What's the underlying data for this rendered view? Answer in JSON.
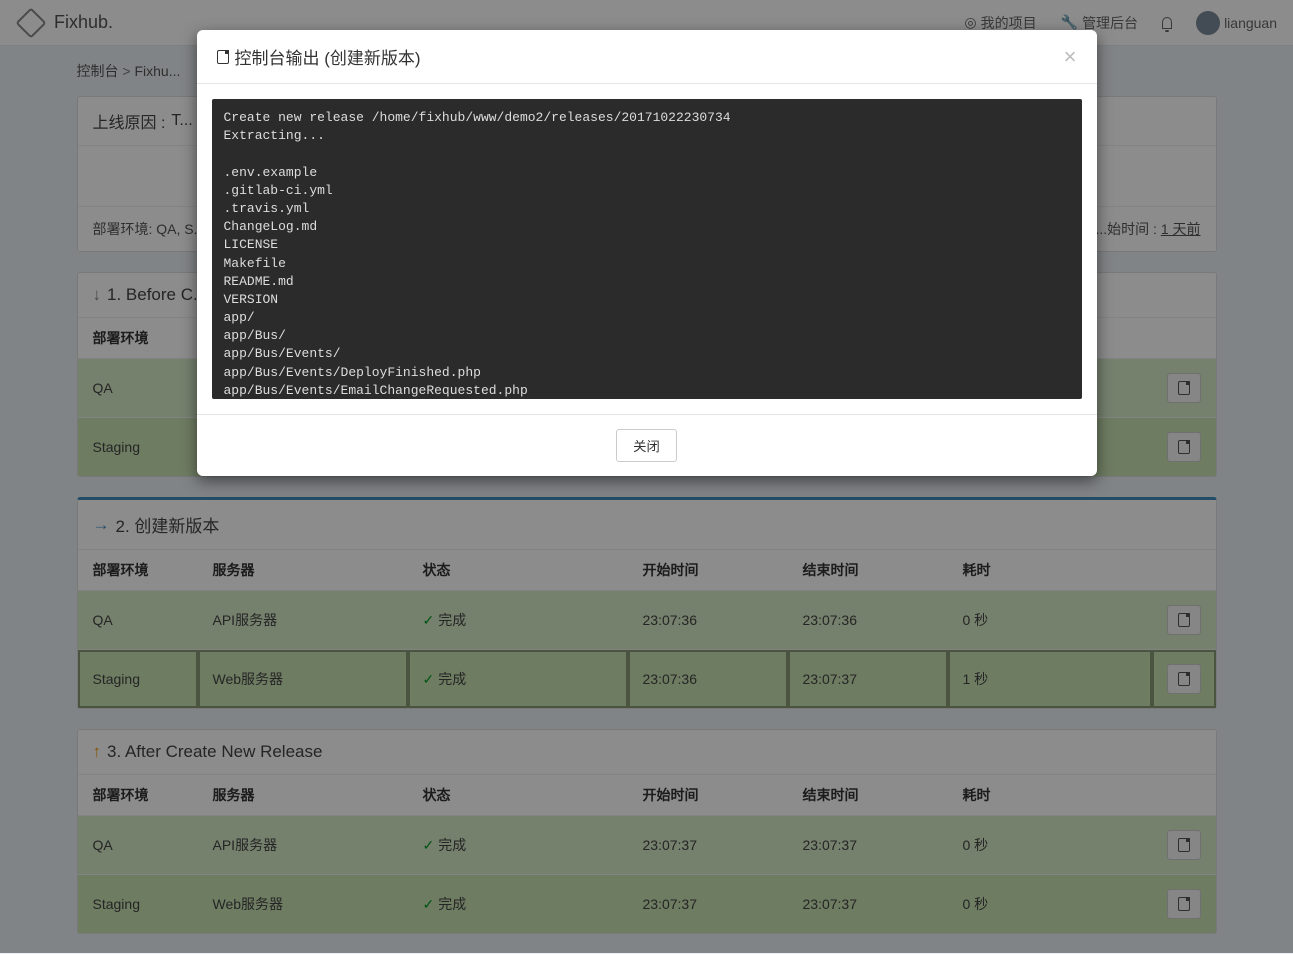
{
  "brand": "Fixhub.",
  "nav": {
    "my_projects": "我的项目",
    "admin": "管理后台",
    "username": "lianguan"
  },
  "breadcrumb": {
    "console": "控制台",
    "project": "Fixhu..."
  },
  "reason": {
    "label": "上线原因 :",
    "value": "T..."
  },
  "meta": {
    "env_label": "部署环境:",
    "env_value": "QA, S...",
    "start_label": "...始时间 :",
    "start_value": "1 天前"
  },
  "columns": {
    "env": "部署环境",
    "server": "服务器",
    "status": "状态",
    "start": "开始时间",
    "end": "结束时间",
    "duration": "耗时"
  },
  "status_done": "完成",
  "servers": {
    "api": "API服务器",
    "web": "Web服务器"
  },
  "steps": [
    {
      "icon": "down",
      "title": "1. Before C...",
      "active": false,
      "rows": [
        {
          "env": "QA"
        },
        {
          "env": "Staging"
        }
      ]
    },
    {
      "icon": "right",
      "title": "2. 创建新版本",
      "active": true,
      "rows": [
        {
          "env": "QA",
          "server": "API服务器",
          "status": "完成",
          "start": "23:07:36",
          "end": "23:07:36",
          "duration": "0 秒",
          "highlight": false
        },
        {
          "env": "Staging",
          "server": "Web服务器",
          "status": "完成",
          "start": "23:07:36",
          "end": "23:07:37",
          "duration": "1 秒",
          "highlight": true
        }
      ]
    },
    {
      "icon": "up",
      "title": "3. After Create New Release",
      "active": false,
      "rows": [
        {
          "env": "QA",
          "server": "API服务器",
          "status": "完成",
          "start": "23:07:37",
          "end": "23:07:37",
          "duration": "0 秒"
        },
        {
          "env": "Staging",
          "server": "Web服务器",
          "status": "完成",
          "start": "23:07:37",
          "end": "23:07:37",
          "duration": "0 秒"
        }
      ]
    }
  ],
  "modal": {
    "title": "控制台输出 (创建新版本)",
    "close_btn": "关闭",
    "console_text": "Create new release /home/fixhub/www/demo2/releases/20171022230734\nExtracting...\n\n.env.example\n.gitlab-ci.yml\n.travis.yml\nChangeLog.md\nLICENSE\nMakefile\nREADME.md\nVERSION\napp/\napp/Bus/\napp/Bus/Events/\napp/Bus/Events/DeployFinished.php\napp/Bus/Events/EmailChangeRequested.php"
  }
}
